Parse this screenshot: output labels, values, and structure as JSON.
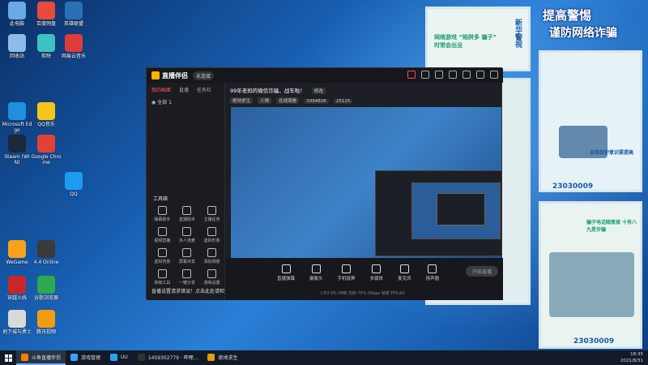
{
  "desktop_icons": [
    {
      "label": "此电脑",
      "color": "#6aa9e8"
    },
    {
      "label": "百度网盘",
      "color": "#e94a3c"
    },
    {
      "label": "英雄联盟",
      "color": "#2c6fb7"
    },
    {
      "label": "回收站",
      "color": "#8fbbe8"
    },
    {
      "label": "剪映",
      "color": "#3cc2c2"
    },
    {
      "label": "网易云音乐",
      "color": "#e03b3b"
    },
    {
      "label": "Microsoft Edge",
      "color": "#1f8fe0"
    },
    {
      "label": "QQ音乐",
      "color": "#f5c518"
    },
    {
      "label": "Steam (WIN)",
      "color": "#1b2838"
    },
    {
      "label": "Google Chrome",
      "color": "#e34133"
    },
    {
      "label": "WeGame",
      "color": "#f7a21b"
    },
    {
      "label": "4.4 Online",
      "color": "#3a3a3a"
    },
    {
      "label": "穿越火线",
      "color": "#c62828"
    },
    {
      "label": "谷歌浏览器",
      "color": "#2fa84f"
    },
    {
      "label": "地下城与勇士",
      "color": "#d9d9d9"
    },
    {
      "label": "腾讯视频",
      "color": "#f39c12"
    },
    {
      "label": "QQ",
      "color": "#1d9bf0"
    }
  ],
  "posters": {
    "top_title": "提高警惕",
    "top_sub": "谨防网络诈骗",
    "p1_text": "网络游戏 “陷阱多 骗子” 时常会出没",
    "p2_text": "自我保护意识要提高",
    "p2_hotline": "23030009",
    "p3_text": "骗子电话随意接 十有八九是诈骗",
    "p4_text": "新华警视"
  },
  "window": {
    "app_name": "直播伴侣",
    "app_badge": "未连接",
    "tabs": [
      "我的画面",
      "直播",
      "任务栏"
    ],
    "scene_name": "全部 1",
    "stream_title": "99年老妈的微信诈骗，战车啦！",
    "edit_label": "修改",
    "chips": [
      "绝地求生",
      "人物",
      "在线观看",
      "1994826",
      "25125"
    ],
    "tools_title": "工具箱",
    "tools": [
      "弹幕助手",
      "直播助手",
      "主播任务",
      "视频直播",
      "多人连麦",
      "虚拟形象",
      "虚拟背景",
      "屏幕共享",
      "添加场景",
      "高级工具",
      "一键分享",
      "游戏设置"
    ],
    "status_warning": "直播设置请求错误！点击此处请检查直播设置！",
    "bottom_items": [
      "直播弹幕",
      "摄像头",
      "手机投屏",
      "多媒体",
      "麦克风",
      "扬声器"
    ],
    "go_live": "开始直播",
    "stats": "CPU 0% 0MB 内存:75% 0kbps 帧率 FPS:60"
  },
  "taskbar": {
    "tasks": [
      {
        "label": "斗鱼直播伴侣",
        "active": true,
        "color": "#ff7a00"
      },
      {
        "label": "游戏管理",
        "active": false,
        "color": "#3aa0ff"
      },
      {
        "label": "UU",
        "active": false,
        "color": "#2aa0ff"
      },
      {
        "label": "1459302779 · 哔哩...",
        "active": false,
        "color": "#333"
      },
      {
        "label": "绝地求生",
        "active": false,
        "color": "#e0a000"
      }
    ],
    "time": "18:35",
    "date": "2021/8/31"
  }
}
